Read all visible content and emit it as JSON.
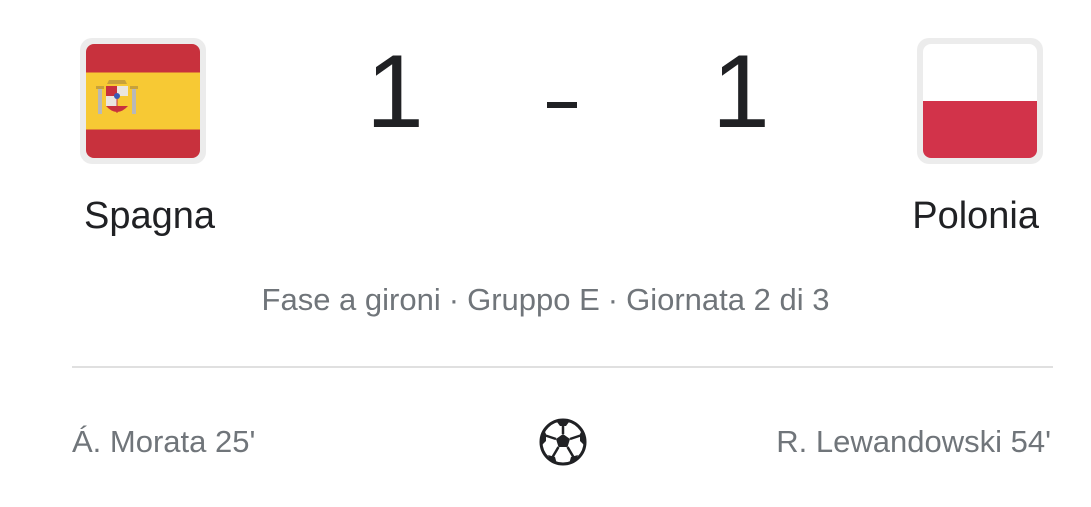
{
  "match": {
    "home": {
      "name": "Spagna",
      "score": "1",
      "flag_icon": "spain-flag-icon",
      "flag_colors": {
        "red": "#c8313d",
        "yellow": "#f7c934"
      }
    },
    "away": {
      "name": "Polonia",
      "score": "1",
      "flag_icon": "poland-flag-icon",
      "flag_colors": {
        "white": "#ffffff",
        "red": "#d2334a"
      }
    },
    "separator": "-",
    "stage": "Fase a gironi",
    "group": "Gruppo E",
    "matchday": "Giornata 2 di 3",
    "meta_separator": "·"
  },
  "goals": {
    "home": "Á. Morata 25'",
    "away": "R. Lewandowski 54'",
    "icon": "soccer-ball-icon"
  },
  "colors": {
    "text_primary": "#202124",
    "text_secondary": "#70757a",
    "divider": "#e0e0e0"
  }
}
